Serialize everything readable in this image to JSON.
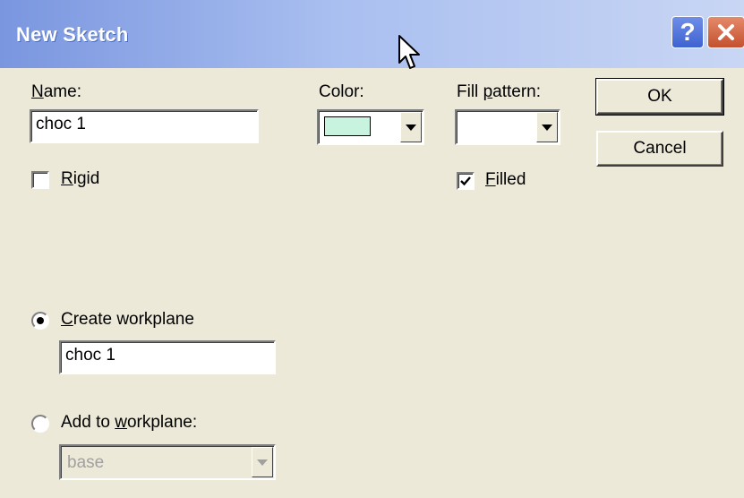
{
  "window": {
    "title": "New Sketch",
    "help_glyph": "?",
    "close_icon": "close-icon"
  },
  "name": {
    "label_underlined": "N",
    "label_rest": "ame:",
    "value": "choc 1"
  },
  "color": {
    "label": "Color:",
    "swatch": "#c8f3df"
  },
  "fill_pattern": {
    "label_pre": "Fill ",
    "label_underlined": "p",
    "label_rest": "attern:",
    "value": ""
  },
  "buttons": {
    "ok": "OK",
    "cancel": "Cancel"
  },
  "rigid": {
    "label_underlined": "R",
    "label_rest": "igid",
    "checked": false
  },
  "filled": {
    "label_underlined": "F",
    "label_rest": "illed",
    "checked": true
  },
  "create_workplane": {
    "label_underlined": "C",
    "label_rest": "reate workplane",
    "selected": true,
    "value": "choc 1"
  },
  "add_to_workplane": {
    "label_pre": "Add to ",
    "label_underlined": "w",
    "label_rest": "orkplane:",
    "selected": false,
    "value": "base",
    "disabled": true
  }
}
